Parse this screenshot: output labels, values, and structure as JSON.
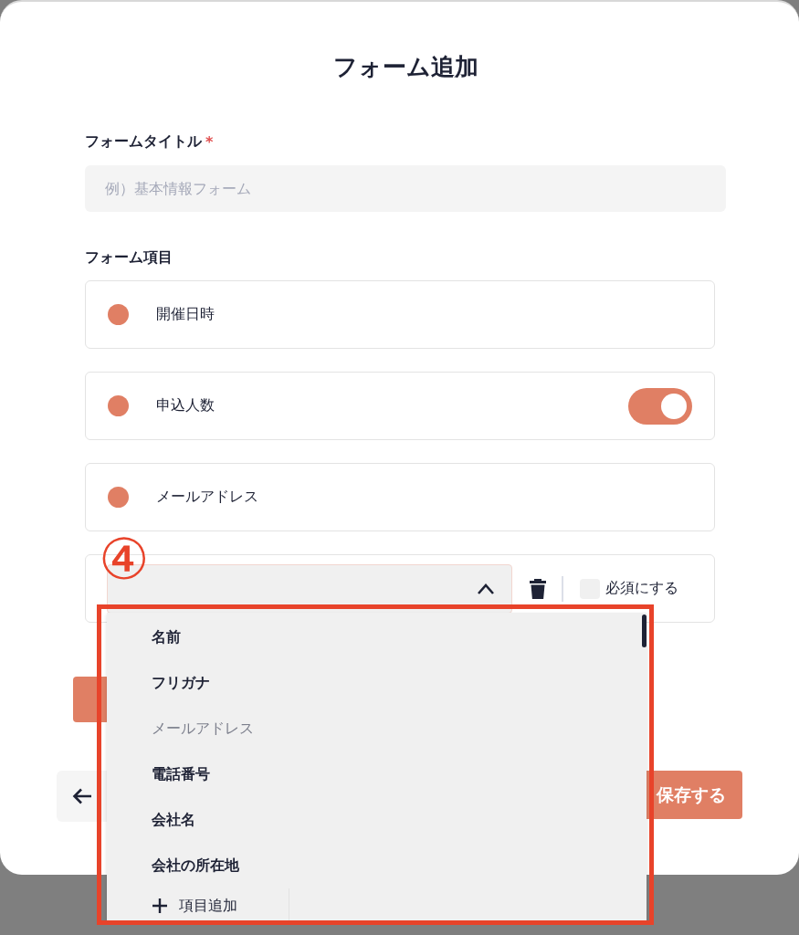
{
  "dialog": {
    "title": "フォーム追加"
  },
  "form_title": {
    "label": "フォームタイトル",
    "required_mark": "*",
    "placeholder": "例）基本情報フォーム"
  },
  "items_section": {
    "label": "フォーム項目"
  },
  "items": [
    {
      "kind": "plain",
      "label": "開催日時",
      "color": "#e07f64"
    },
    {
      "kind": "toggle",
      "label": "申込人数",
      "color": "#e07f64",
      "on": true
    },
    {
      "kind": "plain",
      "label": "メールアドレス",
      "color": "#e07f64"
    }
  ],
  "new_item": {
    "expanded": true,
    "required": {
      "label": "必須にする",
      "checked": false
    },
    "options": [
      {
        "label": "名前",
        "disabled": false
      },
      {
        "label": "フリガナ",
        "disabled": false
      },
      {
        "label": "メールアドレス",
        "disabled": true
      },
      {
        "label": "電話番号",
        "disabled": false
      },
      {
        "label": "会社名",
        "disabled": false
      },
      {
        "label": "会社の所在地",
        "disabled": false
      }
    ],
    "add_option": "項目追加"
  },
  "save_button": "保存する",
  "annotation": "④"
}
